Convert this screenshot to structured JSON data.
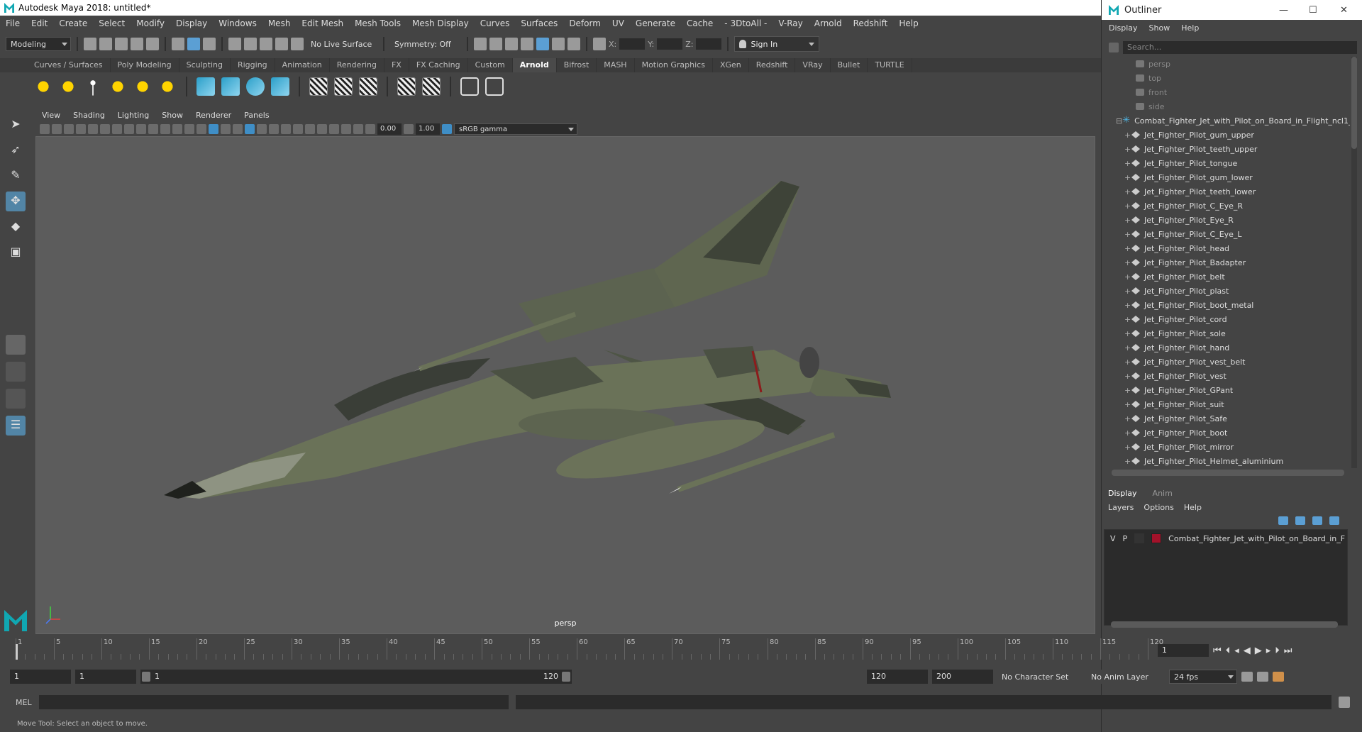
{
  "window": {
    "title": "Autodesk Maya 2018: untitled*"
  },
  "menubar": [
    "File",
    "Edit",
    "Create",
    "Select",
    "Modify",
    "Display",
    "Windows",
    "Mesh",
    "Edit Mesh",
    "Mesh Tools",
    "Mesh Display",
    "Curves",
    "Surfaces",
    "Deform",
    "UV",
    "Generate",
    "Cache",
    "- 3DtoAll -",
    "V-Ray",
    "Arnold",
    "Redshift",
    "Help"
  ],
  "statusline": {
    "mode": "Modeling",
    "live_surface": "No Live Surface",
    "symmetry": "Symmetry: Off",
    "x_label": "X:",
    "y_label": "Y:",
    "z_label": "Z:",
    "sign_in": "Sign In"
  },
  "shelf": {
    "tabs": [
      "Curves / Surfaces",
      "Poly Modeling",
      "Sculpting",
      "Rigging",
      "Animation",
      "Rendering",
      "FX",
      "FX Caching",
      "Custom",
      "Arnold",
      "Bifrost",
      "MASH",
      "Motion Graphics",
      "XGen",
      "Redshift",
      "VRay",
      "Bullet",
      "TURTLE"
    ],
    "active_tab": "Arnold"
  },
  "viewport": {
    "menu": [
      "View",
      "Shading",
      "Lighting",
      "Show",
      "Renderer",
      "Panels"
    ],
    "exposure": "0.00",
    "gamma": "1.00",
    "color_space": "sRGB gamma",
    "camera_label": "persp"
  },
  "outliner": {
    "title": "Outliner",
    "menu": [
      "Display",
      "Show",
      "Help"
    ],
    "search_placeholder": "Search...",
    "cameras": [
      "persp",
      "top",
      "front",
      "side"
    ],
    "group": "Combat_Fighter_Jet_with_Pilot_on_Board_in_Flight_ncl1_",
    "items": [
      "Jet_Fighter_Pilot_gum_upper",
      "Jet_Fighter_Pilot_teeth_upper",
      "Jet_Fighter_Pilot_tongue",
      "Jet_Fighter_Pilot_gum_lower",
      "Jet_Fighter_Pilot_teeth_lower",
      "Jet_Fighter_Pilot_C_Eye_R",
      "Jet_Fighter_Pilot_Eye_R",
      "Jet_Fighter_Pilot_C_Eye_L",
      "Jet_Fighter_Pilot_head",
      "Jet_Fighter_Pilot_Badapter",
      "Jet_Fighter_Pilot_belt",
      "Jet_Fighter_Pilot_plast",
      "Jet_Fighter_Pilot_boot_metal",
      "Jet_Fighter_Pilot_cord",
      "Jet_Fighter_Pilot_sole",
      "Jet_Fighter_Pilot_hand",
      "Jet_Fighter_Pilot_vest_belt",
      "Jet_Fighter_Pilot_vest",
      "Jet_Fighter_Pilot_GPant",
      "Jet_Fighter_Pilot_suit",
      "Jet_Fighter_Pilot_Safe",
      "Jet_Fighter_Pilot_boot",
      "Jet_Fighter_Pilot_mirror",
      "Jet_Fighter_Pilot_Helmet_aluminium"
    ]
  },
  "layers": {
    "tabs": [
      "Display",
      "Anim"
    ],
    "menu": [
      "Layers",
      "Options",
      "Help"
    ],
    "row": {
      "v": "V",
      "p": "P",
      "name": "Combat_Fighter_Jet_with_Pilot_on_Board_in_Flight",
      "color": "#a3122a"
    }
  },
  "timeline": {
    "ticks": [
      "1",
      "5",
      "10",
      "15",
      "20",
      "25",
      "30",
      "35",
      "40",
      "45",
      "50",
      "55",
      "60",
      "65",
      "70",
      "75",
      "80",
      "85",
      "90",
      "95",
      "100",
      "105",
      "110",
      "115",
      "120"
    ],
    "current_frame": "1"
  },
  "range": {
    "start": "1",
    "playback_start": "1",
    "bar_start": "1",
    "bar_end": "120",
    "playback_end": "120",
    "end": "200",
    "character_set": "No Character Set",
    "anim_layer": "No Anim Layer",
    "fps": "24 fps"
  },
  "command": {
    "label": "MEL"
  },
  "help_line": "Move Tool: Select an object to move."
}
